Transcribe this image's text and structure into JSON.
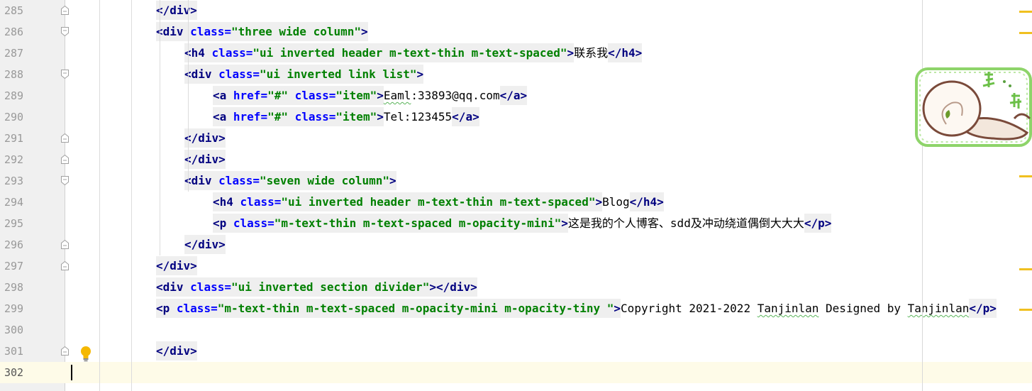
{
  "editor": {
    "lines": [
      {
        "num": "285",
        "indent": 220,
        "fold": "end",
        "seg": [
          {
            "t": "tag",
            "v": "</"
          },
          {
            "t": "tn",
            "v": "div"
          },
          {
            "t": "tag",
            "v": ">"
          }
        ]
      },
      {
        "num": "286",
        "indent": 220,
        "fold": "start",
        "seg": [
          {
            "t": "tag",
            "v": "<"
          },
          {
            "t": "tn",
            "v": "div "
          },
          {
            "t": "an",
            "v": "class="
          },
          {
            "t": "av",
            "v": "\"three wide column\""
          },
          {
            "t": "tag",
            "v": ">"
          }
        ]
      },
      {
        "num": "287",
        "indent": 260,
        "fold": "none",
        "seg": [
          {
            "t": "tag",
            "v": "<"
          },
          {
            "t": "tn",
            "v": "h4 "
          },
          {
            "t": "an",
            "v": "class="
          },
          {
            "t": "av",
            "v": "\"ui inverted header m-text-thin m-text-spaced\""
          },
          {
            "t": "tag",
            "v": ">"
          },
          {
            "t": "txt",
            "v": "联系我"
          },
          {
            "t": "tag",
            "v": "</"
          },
          {
            "t": "tn",
            "v": "h4"
          },
          {
            "t": "tag",
            "v": ">"
          }
        ]
      },
      {
        "num": "288",
        "indent": 260,
        "fold": "start",
        "seg": [
          {
            "t": "tag",
            "v": "<"
          },
          {
            "t": "tn",
            "v": "div "
          },
          {
            "t": "an",
            "v": "class="
          },
          {
            "t": "av",
            "v": "\"ui inverted link list\""
          },
          {
            "t": "tag",
            "v": ">"
          }
        ]
      },
      {
        "num": "289",
        "indent": 300,
        "fold": "none",
        "seg": [
          {
            "t": "tag",
            "v": "<"
          },
          {
            "t": "tn",
            "v": "a "
          },
          {
            "t": "an",
            "v": "href="
          },
          {
            "t": "av",
            "v": "\"#\" "
          },
          {
            "t": "an",
            "v": "class="
          },
          {
            "t": "av",
            "v": "\"item\""
          },
          {
            "t": "tag",
            "v": ">"
          },
          {
            "t": "typo",
            "v": "Eaml"
          },
          {
            "t": "txt",
            "v": ":33893@qq.com"
          },
          {
            "t": "tag",
            "v": "</"
          },
          {
            "t": "tn",
            "v": "a"
          },
          {
            "t": "tag",
            "v": ">"
          }
        ]
      },
      {
        "num": "290",
        "indent": 300,
        "fold": "none",
        "seg": [
          {
            "t": "tag",
            "v": "<"
          },
          {
            "t": "tn",
            "v": "a "
          },
          {
            "t": "an",
            "v": "href="
          },
          {
            "t": "av",
            "v": "\"#\" "
          },
          {
            "t": "an",
            "v": "class="
          },
          {
            "t": "av",
            "v": "\"item\""
          },
          {
            "t": "tag",
            "v": ">"
          },
          {
            "t": "txt",
            "v": "Tel:123455"
          },
          {
            "t": "tag",
            "v": "</"
          },
          {
            "t": "tn",
            "v": "a"
          },
          {
            "t": "tag",
            "v": ">"
          }
        ]
      },
      {
        "num": "291",
        "indent": 260,
        "fold": "end",
        "seg": [
          {
            "t": "tag",
            "v": "</"
          },
          {
            "t": "tn",
            "v": "div"
          },
          {
            "t": "tag",
            "v": ">"
          }
        ]
      },
      {
        "num": "292",
        "indent": 260,
        "fold": "end",
        "seg": [
          {
            "t": "tag",
            "v": "</"
          },
          {
            "t": "tn",
            "v": "div"
          },
          {
            "t": "tag",
            "v": ">"
          }
        ]
      },
      {
        "num": "293",
        "indent": 260,
        "fold": "start",
        "seg": [
          {
            "t": "tag",
            "v": "<"
          },
          {
            "t": "tn",
            "v": "div "
          },
          {
            "t": "an",
            "v": "class="
          },
          {
            "t": "av",
            "v": "\"seven wide column\""
          },
          {
            "t": "tag",
            "v": ">"
          }
        ]
      },
      {
        "num": "294",
        "indent": 300,
        "fold": "none",
        "seg": [
          {
            "t": "tag",
            "v": "<"
          },
          {
            "t": "tn",
            "v": "h4 "
          },
          {
            "t": "an",
            "v": "class="
          },
          {
            "t": "av",
            "v": "\"ui inverted header m-text-thin m-text-spaced\""
          },
          {
            "t": "tag",
            "v": ">"
          },
          {
            "t": "txt",
            "v": "Blog"
          },
          {
            "t": "tag",
            "v": "</"
          },
          {
            "t": "tn",
            "v": "h4"
          },
          {
            "t": "tag",
            "v": ">"
          }
        ]
      },
      {
        "num": "295",
        "indent": 300,
        "fold": "none",
        "seg": [
          {
            "t": "tag",
            "v": "<"
          },
          {
            "t": "tn",
            "v": "p "
          },
          {
            "t": "an",
            "v": "class="
          },
          {
            "t": "av",
            "v": "\"m-text-thin m-text-spaced m-opacity-mini\""
          },
          {
            "t": "tag",
            "v": ">"
          },
          {
            "t": "txt",
            "v": "这是我的个人博客、sdd及冲动绕道偶倒大大大"
          },
          {
            "t": "tag",
            "v": "</"
          },
          {
            "t": "tn",
            "v": "p"
          },
          {
            "t": "tag",
            "v": ">"
          }
        ]
      },
      {
        "num": "296",
        "indent": 260,
        "fold": "end",
        "seg": [
          {
            "t": "tag",
            "v": "</"
          },
          {
            "t": "tn",
            "v": "div"
          },
          {
            "t": "tag",
            "v": ">"
          }
        ]
      },
      {
        "num": "297",
        "indent": 220,
        "fold": "end",
        "seg": [
          {
            "t": "tag",
            "v": "</"
          },
          {
            "t": "tn",
            "v": "div"
          },
          {
            "t": "tag",
            "v": ">"
          }
        ]
      },
      {
        "num": "298",
        "indent": 220,
        "fold": "none",
        "seg": [
          {
            "t": "tag",
            "v": "<"
          },
          {
            "t": "tn",
            "v": "div "
          },
          {
            "t": "an",
            "v": "class="
          },
          {
            "t": "av",
            "v": "\"ui inverted section divider\""
          },
          {
            "t": "tag",
            "v": "></"
          },
          {
            "t": "tn",
            "v": "div"
          },
          {
            "t": "tag",
            "v": ">"
          }
        ]
      },
      {
        "num": "299",
        "indent": 220,
        "fold": "none",
        "seg": [
          {
            "t": "tag",
            "v": "<"
          },
          {
            "t": "tn",
            "v": "p "
          },
          {
            "t": "an",
            "v": "class="
          },
          {
            "t": "av",
            "v": "\"m-text-thin m-text-spaced m-opacity-mini m-opacity-tiny \""
          },
          {
            "t": "tag",
            "v": ">"
          },
          {
            "t": "txt",
            "v": "Copyright 2021-2022 "
          },
          {
            "t": "typo",
            "v": "Tanjinlan"
          },
          {
            "t": "txt",
            "v": " Designed by "
          },
          {
            "t": "typo",
            "v": "Tanjinlan"
          },
          {
            "t": "tag",
            "v": "</"
          },
          {
            "t": "tn",
            "v": "p"
          },
          {
            "t": "tag",
            "v": ">"
          }
        ]
      },
      {
        "num": "300",
        "indent": 220,
        "fold": "none",
        "seg": []
      },
      {
        "num": "301",
        "indent": 220,
        "fold": "end",
        "bulb": true,
        "seg": [
          {
            "t": "tag",
            "v": "</"
          },
          {
            "t": "tn",
            "v": "div"
          },
          {
            "t": "tag",
            "v": ">"
          }
        ]
      },
      {
        "num": "302",
        "indent": 100,
        "fold": "none",
        "current": true,
        "seg": []
      }
    ]
  },
  "colors": {
    "tag_name": "#000080",
    "attr_name": "#0000ff",
    "attr_value": "#008000",
    "tag_bg": "#efefef",
    "current_line": "#fefbe8",
    "scroll_mark": "#f0c020"
  },
  "icons": {
    "fold_start": "fold-start-icon",
    "fold_end": "fold-end-icon",
    "intention": "lightbulb-icon",
    "sticker": "snail-sticker-image"
  }
}
